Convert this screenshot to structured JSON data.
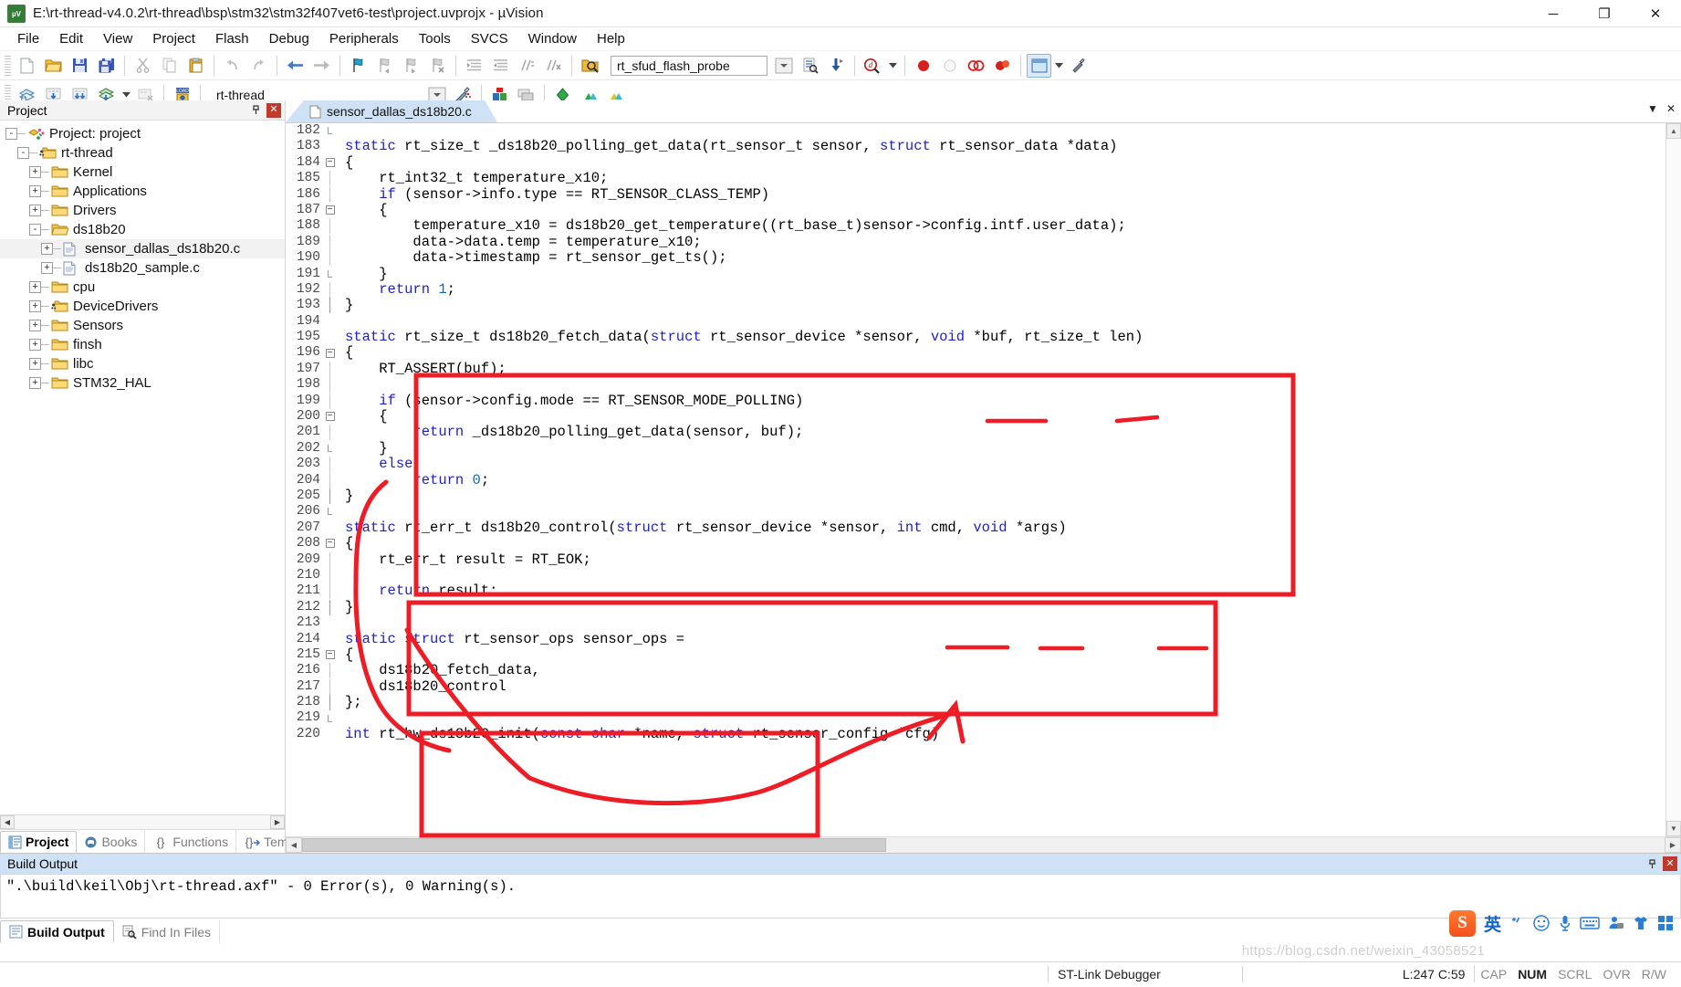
{
  "window": {
    "title": "E:\\rt-thread-v4.0.2\\rt-thread\\bsp\\stm32\\stm32f407vet6-test\\project.uvprojx - µVision",
    "app_icon_label": "µV",
    "minimize": "─",
    "maximize": "❐",
    "close": "✕"
  },
  "menu": [
    "File",
    "Edit",
    "View",
    "Project",
    "Flash",
    "Debug",
    "Peripherals",
    "Tools",
    "SVCS",
    "Window",
    "Help"
  ],
  "toolbar1": {
    "function_combo_value": "rt_sfud_flash_probe",
    "icons": [
      "new-file-icon",
      "open-file-icon",
      "save-icon",
      "save-all-icon",
      "cut-icon",
      "copy-icon",
      "paste-icon",
      "undo-icon",
      "redo-icon",
      "navigate-back-icon",
      "navigate-forward-icon",
      "bookmark-toggle-icon",
      "bookmark-prev-icon",
      "bookmark-next-icon",
      "bookmark-clear-icon",
      "indent-icon",
      "outdent-icon",
      "comment-icon",
      "uncomment-icon",
      "browse-icon",
      "goto-definition-icon",
      "insert-bookmark-icon",
      "find-in-files-icon",
      "start-debug-icon",
      "stop-debug-icon",
      "insert-breakpoint-icon",
      "kill-breakpoints-icon",
      "window-layout-icon",
      "configure-icon"
    ]
  },
  "toolbar2": {
    "target_combo_value": "rt-thread",
    "icons": [
      "translate-icon",
      "build-icon",
      "rebuild-icon",
      "batch-build-icon",
      "stop-build-icon",
      "download-icon",
      "target-options-icon",
      "manage-project-items-icon",
      "multi-project-icon",
      "configuration-wizard-icon",
      "pack-installer-icon",
      "pack-installer-2-icon"
    ]
  },
  "project_panel": {
    "title": "Project",
    "pin_icon": "pin-icon",
    "close_icon": "close-icon",
    "tree": [
      {
        "label": "Project: project",
        "indent": 0,
        "toggle": "-",
        "icon": "project-icon",
        "selected": false
      },
      {
        "label": "rt-thread",
        "indent": 1,
        "toggle": "-",
        "icon": "target-folder-icon",
        "selected": false
      },
      {
        "label": "Kernel",
        "indent": 2,
        "toggle": "+",
        "icon": "folder-icon",
        "selected": false
      },
      {
        "label": "Applications",
        "indent": 2,
        "toggle": "+",
        "icon": "folder-icon",
        "selected": false
      },
      {
        "label": "Drivers",
        "indent": 2,
        "toggle": "+",
        "icon": "folder-icon",
        "selected": false
      },
      {
        "label": "ds18b20",
        "indent": 2,
        "toggle": "-",
        "icon": "folder-open-icon",
        "selected": false
      },
      {
        "label": "sensor_dallas_ds18b20.c",
        "indent": 3,
        "toggle": "+",
        "icon": "c-file-icon",
        "selected": true
      },
      {
        "label": "ds18b20_sample.c",
        "indent": 3,
        "toggle": "+",
        "icon": "c-file-icon",
        "selected": false
      },
      {
        "label": "cpu",
        "indent": 2,
        "toggle": "+",
        "icon": "folder-icon",
        "selected": false
      },
      {
        "label": "DeviceDrivers",
        "indent": 2,
        "toggle": "+",
        "icon": "target-folder-icon",
        "selected": false
      },
      {
        "label": "Sensors",
        "indent": 2,
        "toggle": "+",
        "icon": "folder-icon",
        "selected": false
      },
      {
        "label": "finsh",
        "indent": 2,
        "toggle": "+",
        "icon": "folder-icon",
        "selected": false
      },
      {
        "label": "libc",
        "indent": 2,
        "toggle": "+",
        "icon": "folder-icon",
        "selected": false
      },
      {
        "label": "STM32_HAL",
        "indent": 2,
        "toggle": "+",
        "icon": "folder-icon",
        "selected": false
      }
    ],
    "tabs": [
      {
        "label": "Project",
        "icon": "project-tab-icon",
        "active": true
      },
      {
        "label": "Books",
        "icon": "books-tab-icon",
        "active": false
      },
      {
        "label": "Functions",
        "icon": "functions-tab-icon",
        "active": false
      },
      {
        "label": "Templates",
        "icon": "templates-tab-icon",
        "active": false
      }
    ]
  },
  "editor": {
    "tab_label": "sensor_dallas_ds18b20.c",
    "tab_icon": "c-file-icon",
    "dropdown_icon": "chevron-down-icon",
    "close_icon": "close-icon",
    "first_line": 182,
    "lines": [
      {
        "n": 182,
        "fold": "end",
        "tokens": [
          {
            "t": "    ",
            "c": ""
          }
        ]
      },
      {
        "n": 183,
        "fold": "",
        "tokens": [
          {
            "t": "static",
            "c": "kw"
          },
          {
            "t": " rt_size_t _ds18b20_polling_get_data(rt_sensor_t sensor, ",
            "c": ""
          },
          {
            "t": "struct",
            "c": "kw"
          },
          {
            "t": " rt_sensor_data *data)",
            "c": ""
          }
        ]
      },
      {
        "n": 184,
        "fold": "box",
        "tokens": [
          {
            "t": "{",
            "c": ""
          }
        ]
      },
      {
        "n": 185,
        "fold": "bar",
        "tokens": [
          {
            "t": "    rt_int32_t temperature_x10;",
            "c": ""
          }
        ]
      },
      {
        "n": 186,
        "fold": "bar",
        "tokens": [
          {
            "t": "    ",
            "c": ""
          },
          {
            "t": "if",
            "c": "kw"
          },
          {
            "t": " (sensor->info.type == RT_SENSOR_CLASS_TEMP)",
            "c": ""
          }
        ]
      },
      {
        "n": 187,
        "fold": "box",
        "tokens": [
          {
            "t": "    {",
            "c": ""
          }
        ]
      },
      {
        "n": 188,
        "fold": "bar",
        "tokens": [
          {
            "t": "        temperature_x10 = ds18b20_get_temperature((rt_base_t)sensor->config.intf.user_data);",
            "c": ""
          }
        ]
      },
      {
        "n": 189,
        "fold": "bar",
        "tokens": [
          {
            "t": "        data->data.temp = temperature_x10;",
            "c": ""
          }
        ]
      },
      {
        "n": 190,
        "fold": "bar",
        "tokens": [
          {
            "t": "        data->timestamp = rt_sensor_get_ts();",
            "c": ""
          }
        ]
      },
      {
        "n": 191,
        "fold": "end",
        "tokens": [
          {
            "t": "    }",
            "c": ""
          }
        ]
      },
      {
        "n": 192,
        "fold": "bar",
        "tokens": [
          {
            "t": "    ",
            "c": ""
          },
          {
            "t": "return",
            "c": "kw"
          },
          {
            "t": " ",
            "c": ""
          },
          {
            "t": "1",
            "c": "num"
          },
          {
            "t": ";",
            "c": ""
          }
        ]
      },
      {
        "n": 193,
        "fold": "end2",
        "tokens": [
          {
            "t": "}",
            "c": ""
          }
        ]
      },
      {
        "n": 194,
        "fold": "",
        "tokens": [
          {
            "t": "",
            "c": ""
          }
        ]
      },
      {
        "n": 195,
        "fold": "",
        "tokens": [
          {
            "t": "static",
            "c": "kw"
          },
          {
            "t": " rt_size_t ds18b20_fetch_data(",
            "c": ""
          },
          {
            "t": "struct",
            "c": "kw"
          },
          {
            "t": " rt_sensor_device *sensor, ",
            "c": ""
          },
          {
            "t": "void",
            "c": "kw"
          },
          {
            "t": " *buf, rt_size_t len)",
            "c": ""
          }
        ]
      },
      {
        "n": 196,
        "fold": "box",
        "tokens": [
          {
            "t": "{",
            "c": ""
          }
        ]
      },
      {
        "n": 197,
        "fold": "bar",
        "tokens": [
          {
            "t": "    RT_ASSERT(buf);",
            "c": ""
          }
        ]
      },
      {
        "n": 198,
        "fold": "bar",
        "tokens": [
          {
            "t": "",
            "c": ""
          }
        ]
      },
      {
        "n": 199,
        "fold": "bar",
        "tokens": [
          {
            "t": "    ",
            "c": ""
          },
          {
            "t": "if",
            "c": "kw"
          },
          {
            "t": " (sensor->config.mode == RT_SENSOR_MODE_POLLING)",
            "c": ""
          }
        ]
      },
      {
        "n": 200,
        "fold": "box",
        "tokens": [
          {
            "t": "    {",
            "c": ""
          }
        ]
      },
      {
        "n": 201,
        "fold": "bar",
        "tokens": [
          {
            "t": "        ",
            "c": ""
          },
          {
            "t": "return",
            "c": "kw"
          },
          {
            "t": " _ds18b20_polling_get_data(sensor, buf);",
            "c": ""
          }
        ]
      },
      {
        "n": 202,
        "fold": "end",
        "tokens": [
          {
            "t": "    }",
            "c": ""
          }
        ]
      },
      {
        "n": 203,
        "fold": "bar",
        "tokens": [
          {
            "t": "    ",
            "c": ""
          },
          {
            "t": "else",
            "c": "kw"
          }
        ]
      },
      {
        "n": 204,
        "fold": "bar",
        "tokens": [
          {
            "t": "        ",
            "c": ""
          },
          {
            "t": "return",
            "c": "kw"
          },
          {
            "t": " ",
            "c": ""
          },
          {
            "t": "0",
            "c": "num"
          },
          {
            "t": ";",
            "c": ""
          }
        ]
      },
      {
        "n": 205,
        "fold": "end2",
        "tokens": [
          {
            "t": "}",
            "c": ""
          }
        ]
      },
      {
        "n": 206,
        "fold": "end",
        "tokens": [
          {
            "t": "",
            "c": ""
          }
        ]
      },
      {
        "n": 207,
        "fold": "",
        "tokens": [
          {
            "t": "static",
            "c": "kw"
          },
          {
            "t": " rt_err_t ds18b20_control(",
            "c": ""
          },
          {
            "t": "struct",
            "c": "kw"
          },
          {
            "t": " rt_sensor_device *sensor, ",
            "c": ""
          },
          {
            "t": "int",
            "c": "kw"
          },
          {
            "t": " cmd, ",
            "c": ""
          },
          {
            "t": "void",
            "c": "kw"
          },
          {
            "t": " *args)",
            "c": ""
          }
        ]
      },
      {
        "n": 208,
        "fold": "box",
        "tokens": [
          {
            "t": "{",
            "c": ""
          }
        ]
      },
      {
        "n": 209,
        "fold": "bar",
        "tokens": [
          {
            "t": "    rt_err_t result = RT_EOK;",
            "c": ""
          }
        ]
      },
      {
        "n": 210,
        "fold": "bar",
        "tokens": [
          {
            "t": "",
            "c": ""
          }
        ]
      },
      {
        "n": 211,
        "fold": "bar",
        "tokens": [
          {
            "t": "    ",
            "c": ""
          },
          {
            "t": "return",
            "c": "kw"
          },
          {
            "t": " result;",
            "c": ""
          }
        ]
      },
      {
        "n": 212,
        "fold": "end2",
        "tokens": [
          {
            "t": "}",
            "c": ""
          }
        ]
      },
      {
        "n": 213,
        "fold": "",
        "tokens": [
          {
            "t": "",
            "c": ""
          }
        ]
      },
      {
        "n": 214,
        "fold": "",
        "tokens": [
          {
            "t": "static",
            "c": "kw"
          },
          {
            "t": " ",
            "c": ""
          },
          {
            "t": "struct",
            "c": "kw"
          },
          {
            "t": " rt_sensor_ops sensor_ops =",
            "c": ""
          }
        ]
      },
      {
        "n": 215,
        "fold": "box",
        "tokens": [
          {
            "t": "{",
            "c": ""
          }
        ]
      },
      {
        "n": 216,
        "fold": "bar",
        "tokens": [
          {
            "t": "    ds18b20_fetch_data,",
            "c": ""
          }
        ]
      },
      {
        "n": 217,
        "fold": "bar",
        "tokens": [
          {
            "t": "    ds18b20_control",
            "c": ""
          }
        ]
      },
      {
        "n": 218,
        "fold": "end2",
        "tokens": [
          {
            "t": "};",
            "c": ""
          }
        ]
      },
      {
        "n": 219,
        "fold": "end",
        "tokens": [
          {
            "t": "",
            "c": ""
          }
        ]
      },
      {
        "n": 220,
        "fold": "",
        "tokens": [
          {
            "t": "int",
            "c": "kw"
          },
          {
            "t": " rt_hw_ds18b20_init(",
            "c": ""
          },
          {
            "t": "const",
            "c": "kw"
          },
          {
            "t": " ",
            "c": ""
          },
          {
            "t": "char",
            "c": "kw"
          },
          {
            "t": " *name, ",
            "c": ""
          },
          {
            "t": "struct",
            "c": "kw"
          },
          {
            "t": " rt_sensor_config *cfg)",
            "c": ""
          }
        ]
      }
    ]
  },
  "annotations": {
    "color": "#ee1c25",
    "shapes": [
      {
        "name": "fetch-data-box",
        "type": "rect"
      },
      {
        "name": "control-box",
        "type": "rect"
      },
      {
        "name": "sensor-ops-box",
        "type": "rect"
      },
      {
        "name": "sensor-underline-1",
        "type": "underline"
      },
      {
        "name": "len-underline",
        "type": "underline"
      },
      {
        "name": "sensor-underline-2",
        "type": "underline"
      },
      {
        "name": "cmd-underline",
        "type": "underline"
      },
      {
        "name": "args-underline",
        "type": "underline"
      },
      {
        "name": "curve-connector",
        "type": "freehand"
      },
      {
        "name": "arrow-connector",
        "type": "freehand-arrow"
      }
    ]
  },
  "build_output": {
    "title": "Build Output",
    "pin_icon": "pin-icon",
    "close_icon": "close-icon",
    "text": "\".\\build\\keil\\Obj\\rt-thread.axf\" - 0 Error(s), 0 Warning(s).",
    "tabs": [
      {
        "label": "Build Output",
        "icon": "build-output-icon",
        "active": true
      },
      {
        "label": "Find In Files",
        "icon": "find-in-files-icon",
        "active": false
      }
    ]
  },
  "status_bar": {
    "debugger": "ST-Link Debugger",
    "cursor": "L:247 C:59",
    "indicators": [
      {
        "label": "CAP",
        "active": false
      },
      {
        "label": "NUM",
        "active": true
      },
      {
        "label": "SCRL",
        "active": false
      },
      {
        "label": "OVR",
        "active": false
      },
      {
        "label": "R/W",
        "active": false
      }
    ]
  },
  "ime_bar": {
    "logo": "S",
    "mode": "英",
    "items": [
      "punctuation-icon",
      "emoji-icon",
      "microphone-icon",
      "keyboard-icon",
      "user-icon",
      "skin-icon",
      "apps-icon"
    ]
  },
  "watermark": "https://blog.csdn.net/weixin_43058521"
}
